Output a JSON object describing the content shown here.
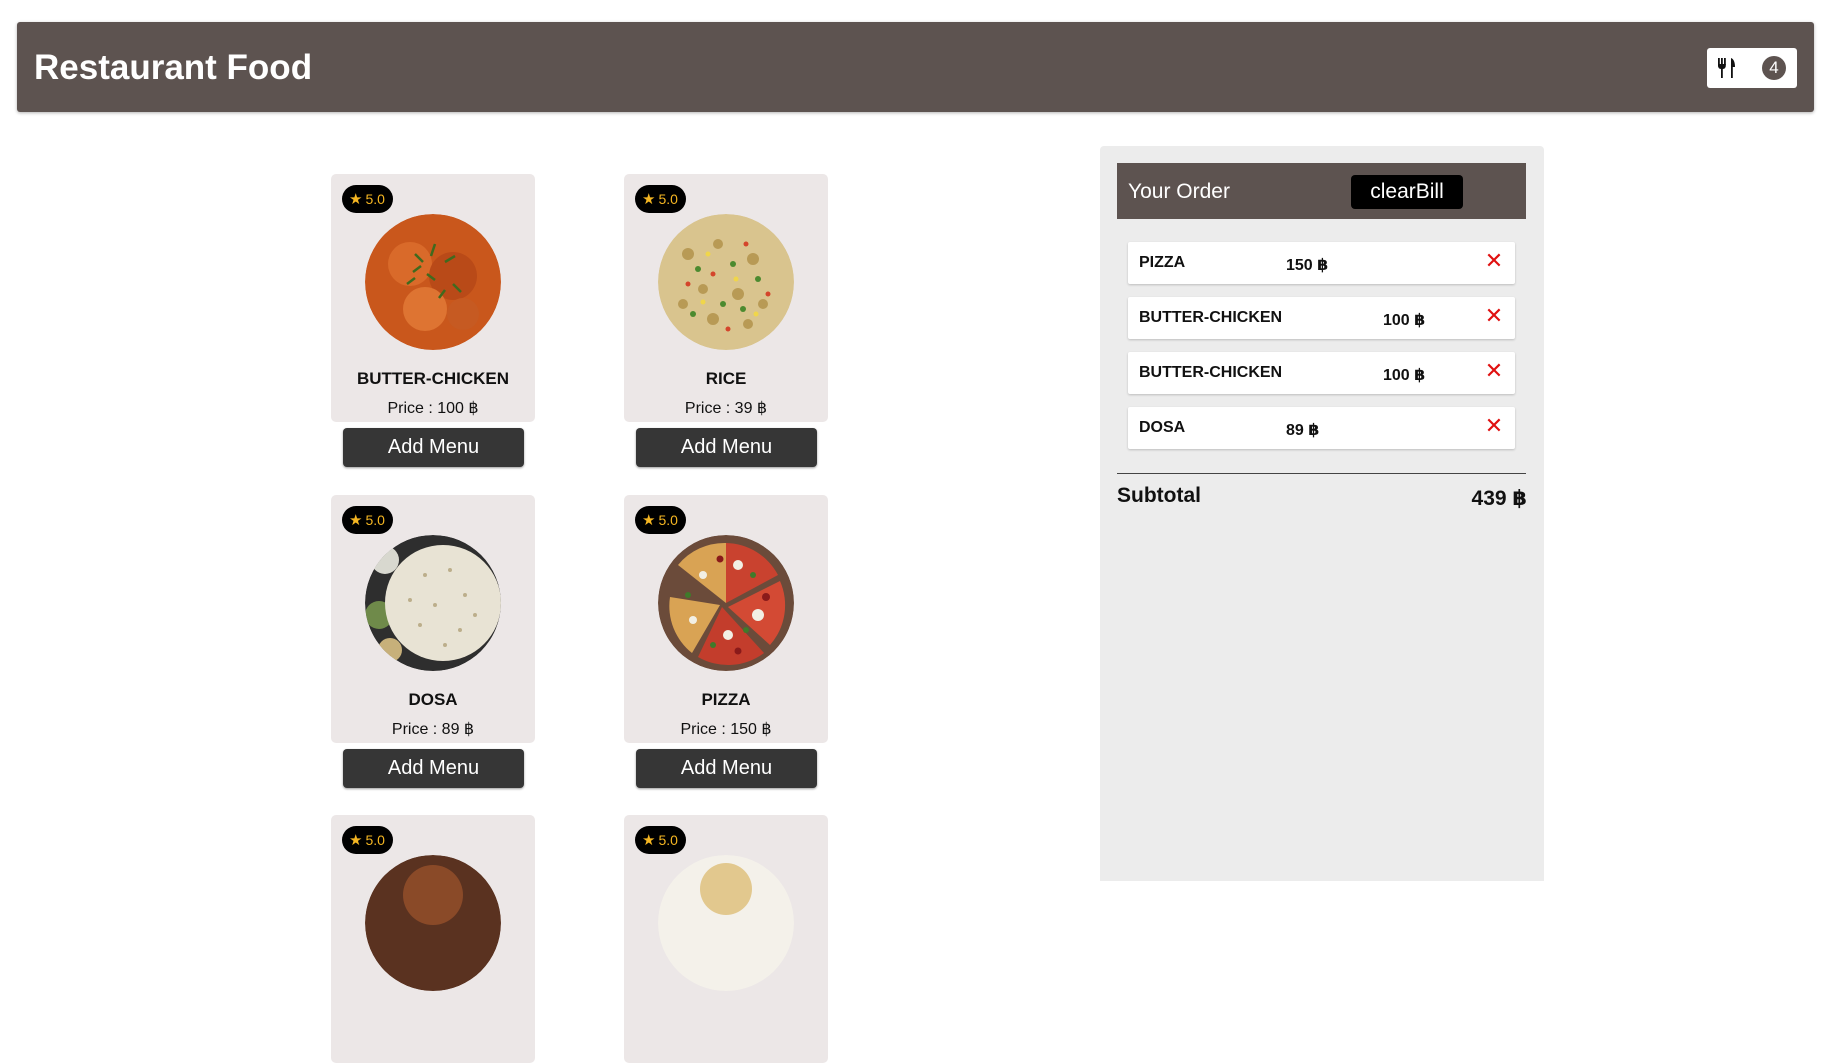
{
  "navbar": {
    "title": "Restaurant Food",
    "cart_icon": "fork-knife-icon",
    "cart_count": "4"
  },
  "menu": {
    "items": [
      {
        "name": "BUTTER-CHICKEN",
        "price": "Price : 100 ฿",
        "rating": "5.0",
        "button": "Add Menu",
        "image": "butter-chicken-image"
      },
      {
        "name": "RICE",
        "price": "Price : 39 ฿",
        "rating": "5.0",
        "button": "Add Menu",
        "image": "rice-image"
      },
      {
        "name": "DOSA",
        "price": "Price : 89 ฿",
        "rating": "5.0",
        "button": "Add Menu",
        "image": "dosa-image"
      },
      {
        "name": "PIZZA",
        "price": "Price : 150 ฿",
        "rating": "5.0",
        "button": "Add Menu",
        "image": "pizza-image"
      },
      {
        "rating": "5.0",
        "image": "food-image"
      },
      {
        "rating": "5.0",
        "image": "food-image"
      }
    ]
  },
  "order": {
    "title": "Your Order",
    "clear_label": "clearBill",
    "items": [
      {
        "name": "PIZZA",
        "price": "150 ฿",
        "remove": "✕"
      },
      {
        "name": "BUTTER-CHICKEN",
        "price": "100 ฿",
        "remove": "✕"
      },
      {
        "name": "BUTTER-CHICKEN",
        "price": "100 ฿",
        "remove": "✕"
      },
      {
        "name": "DOSA",
        "price": "89 ฿",
        "remove": "✕"
      }
    ],
    "subtotal_label": "Subtotal",
    "subtotal_value": "439 ฿"
  },
  "colors": {
    "navbar_bg": "#5d5350",
    "card_bg": "#ece7e7",
    "button_bg": "#363636",
    "rating_star": "#f5b622",
    "remove_x": "#e01010"
  }
}
